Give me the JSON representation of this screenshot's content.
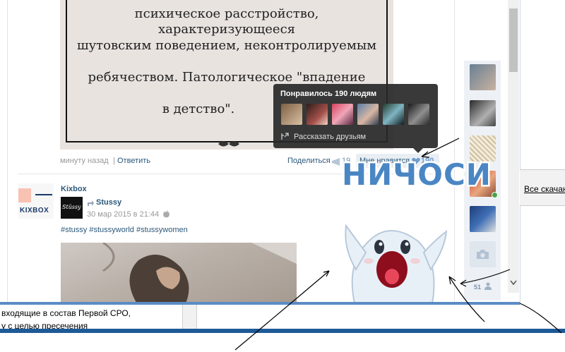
{
  "book": {
    "lines": [
      "психическое расстройство, характеризующееся",
      "шутовским поведением, неконтролируемым",
      "ребячеством. Патологическое \"впадение",
      "в детство\"."
    ]
  },
  "post_actions": {
    "time": "минуту назад",
    "separator": "|",
    "reply": "Ответить",
    "share": "Поделиться",
    "share_count": "19",
    "like": "Мне нравится",
    "like_count": "190"
  },
  "like_tooltip": {
    "title": "Понравилось 190 людям",
    "tell_friends": "Рассказать друзьям"
  },
  "sticker": {
    "text": "НИЧОСИ"
  },
  "next_post": {
    "group_name": "Kixbox",
    "group_logo_text": "KIXBOX",
    "repost_source": "Stussy",
    "repost_logo_text": "Stüssy",
    "date": "30 мар 2015 в 21:44",
    "hashtags": "#stussy #stussyworld #stussywomen"
  },
  "sidebar": {
    "count": "51"
  },
  "background_window": {
    "link_fragment": "Все скачан"
  },
  "document": {
    "line1": "входящие в состав Первой СРО,",
    "line2": "у с целью пресечения"
  },
  "colors": {
    "link": "#2b587a",
    "tooltip_bg": "#282828",
    "sidebar_bg": "#edf1f5",
    "sticker_text": "#4a86c4",
    "like_heart": "#6d9dcd",
    "doc_bar": "#1e5a98"
  }
}
